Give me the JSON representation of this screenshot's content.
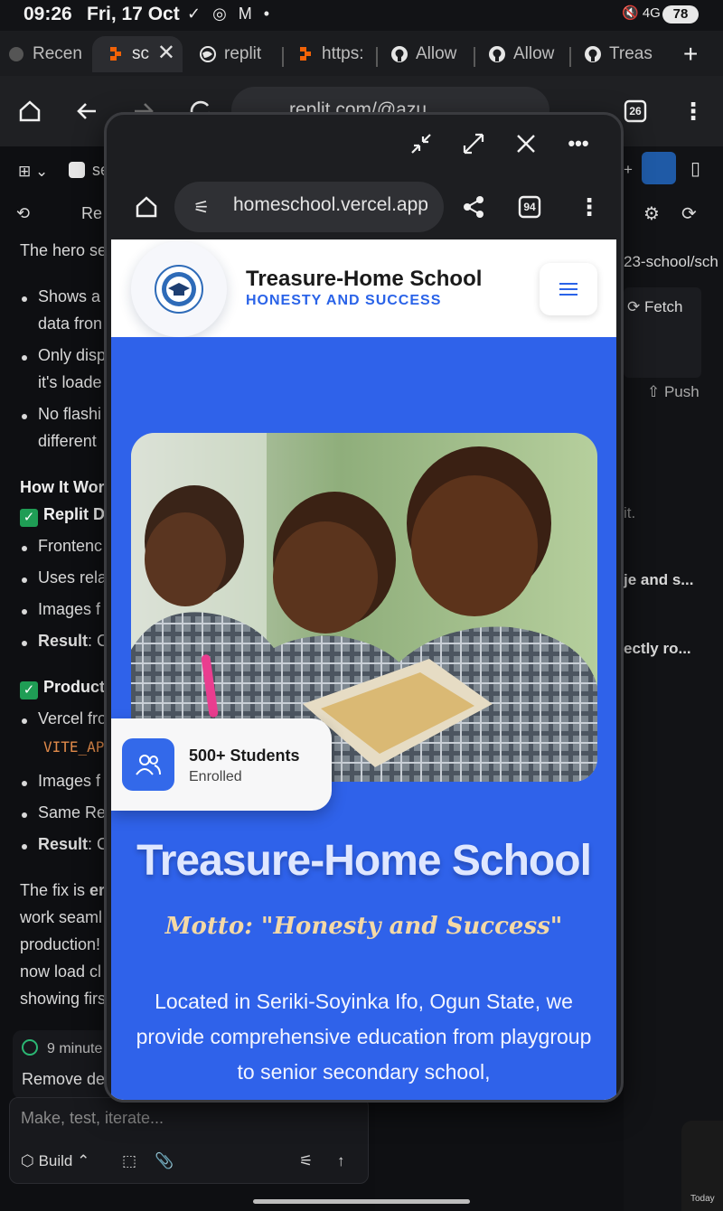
{
  "status_bar": {
    "time": "09:26",
    "date": "Fri, 17 Oct",
    "left_icons": "✓ ◎ M •",
    "right_icons": "🔇 4G ▮",
    "battery": "78"
  },
  "tabs": [
    {
      "label": "Recen",
      "icon": "recent-icon"
    },
    {
      "label": "sc",
      "icon": "replit-icon"
    },
    {
      "label": "replit",
      "icon": "globe-icon"
    },
    {
      "label": "https:",
      "icon": "replit-icon"
    },
    {
      "label": "Allow",
      "icon": "github-icon"
    },
    {
      "label": "Allow",
      "icon": "github-icon"
    },
    {
      "label": "Treas",
      "icon": "github-icon"
    }
  ],
  "back_browser": {
    "url": "replit.com/@azu",
    "tabs_count": "26"
  },
  "left_panel": {
    "top_label": "se",
    "rewind_label": "Re",
    "lines": {
      "l1": "The hero se",
      "b1a": "Shows a",
      "b1b": "data fron",
      "b2a": "Only disp",
      "b2b": "it's loade",
      "b3a": "No flashi",
      "b3b": "different",
      "h1": "How It Wor",
      "h2": "Replit D",
      "c1": "Frontenc",
      "c2": "Uses rela",
      "c3": "Images f",
      "c4_bold": "Result",
      "c4": ": C",
      "h3": "Product",
      "d1": "Vercel fro",
      "code": "VITE_AP",
      "d2": "Images f",
      "d3": "Same Re",
      "d4_bold": "Result",
      "d4": ": C",
      "p1a": "The fix is ",
      "p1a_bold": "er",
      "p1b": "work seaml",
      "p1c": "production!",
      "p1d": "now load cl",
      "p1e": "showing firs"
    },
    "status_time": "9 minute",
    "status_msg": "Remove de",
    "input_placeholder": "Make, test, iterate...",
    "build_label": "Build"
  },
  "right_panel": {
    "path": "23-school/sch",
    "fetch_label": "Fetch",
    "push_label": "Push",
    "it_text": "it.",
    "line1": "je and s...",
    "line2": "ectly ro...",
    "today": "Today"
  },
  "popup": {
    "url": "homeschool.vercel.app",
    "tabs_count": "94"
  },
  "site": {
    "school_name": "Treasure-Home School",
    "tagline": "HONESTY AND SUCCESS",
    "badge_title": "500+ Students",
    "badge_sub": "Enrolled",
    "hero_title": "Treasure-Home School",
    "hero_motto": "Motto: \"Honesty and Success\"",
    "hero_desc": "Located in Seriki-Soyinka Ifo, Ogun State, we provide comprehensive education from playgroup to senior secondary school,"
  },
  "colors": {
    "accent": "#2f62ea",
    "tagline": "#2a63e8",
    "motto": "#f4d9a6"
  }
}
